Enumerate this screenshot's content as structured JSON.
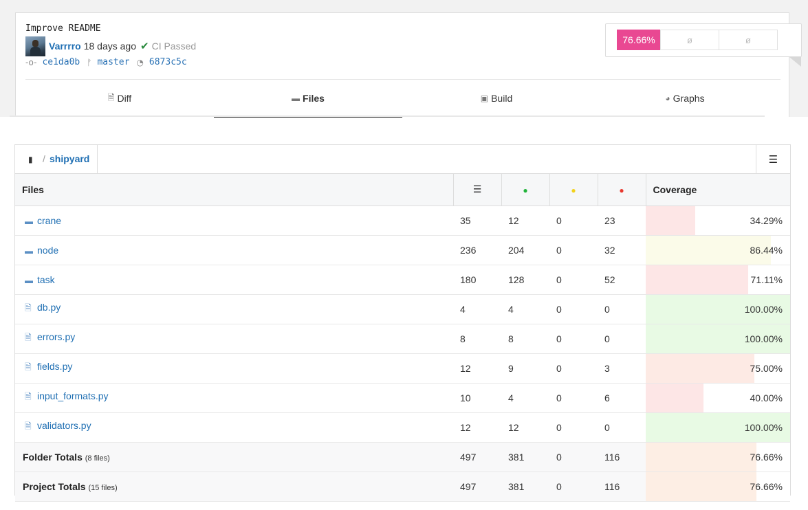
{
  "commit": {
    "title": "Improve README",
    "author": "Varrrro",
    "time": "18 days ago",
    "ci_status": "CI Passed",
    "commit_sha": "ce1da0b",
    "branch": "master",
    "parent_sha": "6873c5c"
  },
  "coverage_pills": {
    "main": "76.66%",
    "second": "ø",
    "third": "ø"
  },
  "tabs": [
    {
      "label": "Diff",
      "icon": "file-diff-icon",
      "active": false
    },
    {
      "label": "Files",
      "icon": "folder-icon",
      "active": true
    },
    {
      "label": "Build",
      "icon": "package-icon",
      "active": false
    },
    {
      "label": "Graphs",
      "icon": "pie-chart-icon",
      "active": false
    }
  ],
  "breadcrumb": {
    "separator": "/",
    "directory": "shipyard"
  },
  "table": {
    "headers": {
      "files": "Files",
      "coverage": "Coverage"
    },
    "header_icons": [
      "lines-icon",
      "hit-dot-icon",
      "partial-dot-icon",
      "miss-dot-icon"
    ],
    "status_colors": {
      "hit": "#21b33a",
      "partial": "#f2d21c",
      "miss": "#e8382e"
    },
    "rows": [
      {
        "name": "crane",
        "type": "folder",
        "lines": "35",
        "hits": "12",
        "partials": "0",
        "misses": "23",
        "coverage": "34.29%",
        "ratio": 0.3429,
        "bar_color": "#fde6e6"
      },
      {
        "name": "node",
        "type": "folder",
        "lines": "236",
        "hits": "204",
        "partials": "0",
        "misses": "32",
        "coverage": "86.44%",
        "ratio": 0.8644,
        "bar_color": "#fbfbe9"
      },
      {
        "name": "task",
        "type": "folder",
        "lines": "180",
        "hits": "128",
        "partials": "0",
        "misses": "52",
        "coverage": "71.11%",
        "ratio": 0.7111,
        "bar_color": "#fde6e6"
      },
      {
        "name": "db.py",
        "type": "file",
        "lines": "4",
        "hits": "4",
        "partials": "0",
        "misses": "0",
        "coverage": "100.00%",
        "ratio": 1.0,
        "bar_color": "#e8fae4"
      },
      {
        "name": "errors.py",
        "type": "file",
        "lines": "8",
        "hits": "8",
        "partials": "0",
        "misses": "0",
        "coverage": "100.00%",
        "ratio": 1.0,
        "bar_color": "#e8fae4"
      },
      {
        "name": "fields.py",
        "type": "file",
        "lines": "12",
        "hits": "9",
        "partials": "0",
        "misses": "3",
        "coverage": "75.00%",
        "ratio": 0.75,
        "bar_color": "#fdeae4"
      },
      {
        "name": "input_formats.py",
        "type": "file",
        "lines": "10",
        "hits": "4",
        "partials": "0",
        "misses": "6",
        "coverage": "40.00%",
        "ratio": 0.4,
        "bar_color": "#fde6e6"
      },
      {
        "name": "validators.py",
        "type": "file",
        "lines": "12",
        "hits": "12",
        "partials": "0",
        "misses": "0",
        "coverage": "100.00%",
        "ratio": 1.0,
        "bar_color": "#e8fae4"
      }
    ],
    "totals": [
      {
        "label": "Folder Totals",
        "sub": "(8 files)",
        "lines": "497",
        "hits": "381",
        "partials": "0",
        "misses": "116",
        "coverage": "76.66%",
        "ratio": 0.7666,
        "bar_color": "#fdeee4"
      },
      {
        "label": "Project Totals",
        "sub": "(15 files)",
        "lines": "497",
        "hits": "381",
        "partials": "0",
        "misses": "116",
        "coverage": "76.66%",
        "ratio": 0.7666,
        "bar_color": "#fdeee4"
      }
    ]
  }
}
